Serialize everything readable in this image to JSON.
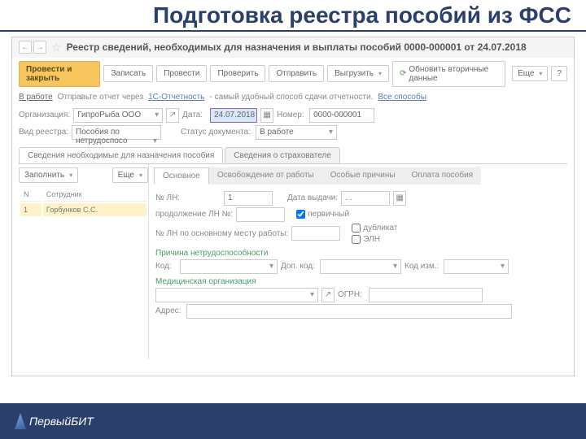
{
  "slide": {
    "title": "Подготовка реестра пособий из ФСС"
  },
  "window": {
    "title": "Реестр сведений, необходимых для назначения и выплаты пособий 0000-000001 от 24.07.2018"
  },
  "toolbar": {
    "primary": "Провести и закрыть",
    "write": "Записать",
    "post": "Провести",
    "check": "Проверить",
    "send": "Отправить",
    "export": "Выгрузить",
    "refresh": "Обновить вторичные данные",
    "more": "Еще",
    "help": "?"
  },
  "status_row": {
    "status": "В работе",
    "hint_prefix": "Отправьте отчет через",
    "hint_link": "1С-Отчетность",
    "hint_suffix": "- самый удобный способ сдачи отчетности.",
    "all_ways": "Все способы"
  },
  "form": {
    "org_label": "Организация:",
    "org_value": "ГипроРыба ООО",
    "date_label": "Дата:",
    "date_value": "24.07.2018",
    "num_label": "Номер:",
    "num_value": "0000-000001",
    "kind_label": "Вид реестра:",
    "kind_value": "Пособия по нетрудоспосо",
    "doc_status_label": "Статус документа:",
    "doc_status_value": "В работе"
  },
  "tabs": {
    "t1": "Сведения необходимые для назначения пособия",
    "t2": "Сведения о страхователе"
  },
  "left": {
    "fill": "Заполнить",
    "more": "Еще",
    "col_n": "N",
    "col_emp": "Сотрудник",
    "rows": [
      {
        "n": "1",
        "name": "Горбунков С.С."
      }
    ]
  },
  "subtabs": {
    "s1": "Основное",
    "s2": "Освобождение от работы",
    "s3": "Особые причины",
    "s4": "Оплата пособия"
  },
  "detail": {
    "ln_no_label": "№ ЛН:",
    "ln_no_value": "1",
    "issue_label": "Дата выдачи:",
    "issue_value": ". .",
    "cont_label": "продолжение ЛН №:",
    "main_ln_label": "№ ЛН по основному месту работы:",
    "chk_primary": "первичный",
    "chk_dup": "дубликат",
    "chk_eln": "ЭЛН",
    "reason_head": "Причина нетрудоспособности",
    "code_label": "Код:",
    "addcode_label": "Доп. код:",
    "chgcode_label": "Код изм.:",
    "medorg_head": "Медицинская организация",
    "ogrn_label": "ОГРН:",
    "addr_label": "Адрес:"
  },
  "footer": {
    "brand": "ПервыйБИТ"
  }
}
